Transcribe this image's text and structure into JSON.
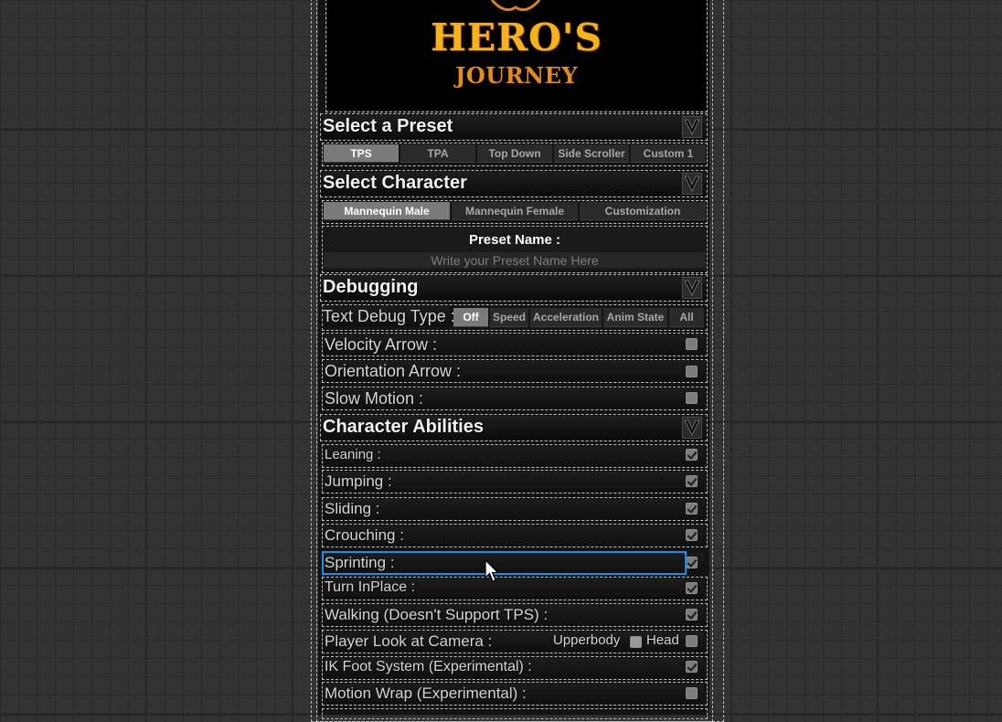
{
  "logo": {
    "line1": "HERO'S",
    "line2": "JOURNEY"
  },
  "preset_section": {
    "title": "Select a Preset",
    "tabs": [
      "TPS",
      "TPA",
      "Top Down",
      "Side Scroller",
      "Custom 1"
    ],
    "active": "TPS"
  },
  "character_section": {
    "title": "Select Character",
    "tabs": [
      "Mannequin Male",
      "Mannequin Female",
      "Customization"
    ],
    "active": "Mannequin Male"
  },
  "preset_name": {
    "label": "Preset Name :",
    "placeholder": "Write your Preset Name Here",
    "value": ""
  },
  "debugging": {
    "title": "Debugging",
    "text_debug_label": "Text Debug Type :",
    "text_debug_options": [
      "Off",
      "Speed",
      "Acceleration",
      "Anim State",
      "All"
    ],
    "text_debug_selected": "Off",
    "options": [
      {
        "label": "Velocity Arrow :",
        "checked": false
      },
      {
        "label": "Orientation Arrow :",
        "checked": false
      },
      {
        "label": "Slow Motion :",
        "checked": false
      }
    ]
  },
  "abilities": {
    "title": "Character Abilities",
    "items": [
      {
        "label": "Leaning :",
        "checked": true
      },
      {
        "label": "Jumping :",
        "checked": true
      },
      {
        "label": "Sliding :",
        "checked": true
      },
      {
        "label": "Crouching :",
        "checked": true
      },
      {
        "label": "Sprinting :",
        "checked": true
      },
      {
        "label": "Turn InPlace :",
        "checked": true
      },
      {
        "label": "Walking (Doesn't Support TPS) :",
        "checked": true
      },
      {
        "label": "Player Look at Camera :",
        "checked": false
      },
      {
        "label": "IK Foot System (Experimental) :",
        "checked": true
      },
      {
        "label": "Motion Wrap (Experimental) :",
        "checked": false
      }
    ],
    "look_at_upperbody_label": "Upperbody",
    "look_at_upperbody_checked": false,
    "look_at_head_label": "Head",
    "look_at_head_checked": false
  },
  "colors": {
    "accent_selection": "#1a8fe6",
    "logo_gold": "#f6b21a",
    "logo_orange": "#e88a1a"
  },
  "icons": [
    "chevron-down-icon",
    "checkbox-icon",
    "mouse-cursor-icon"
  ]
}
